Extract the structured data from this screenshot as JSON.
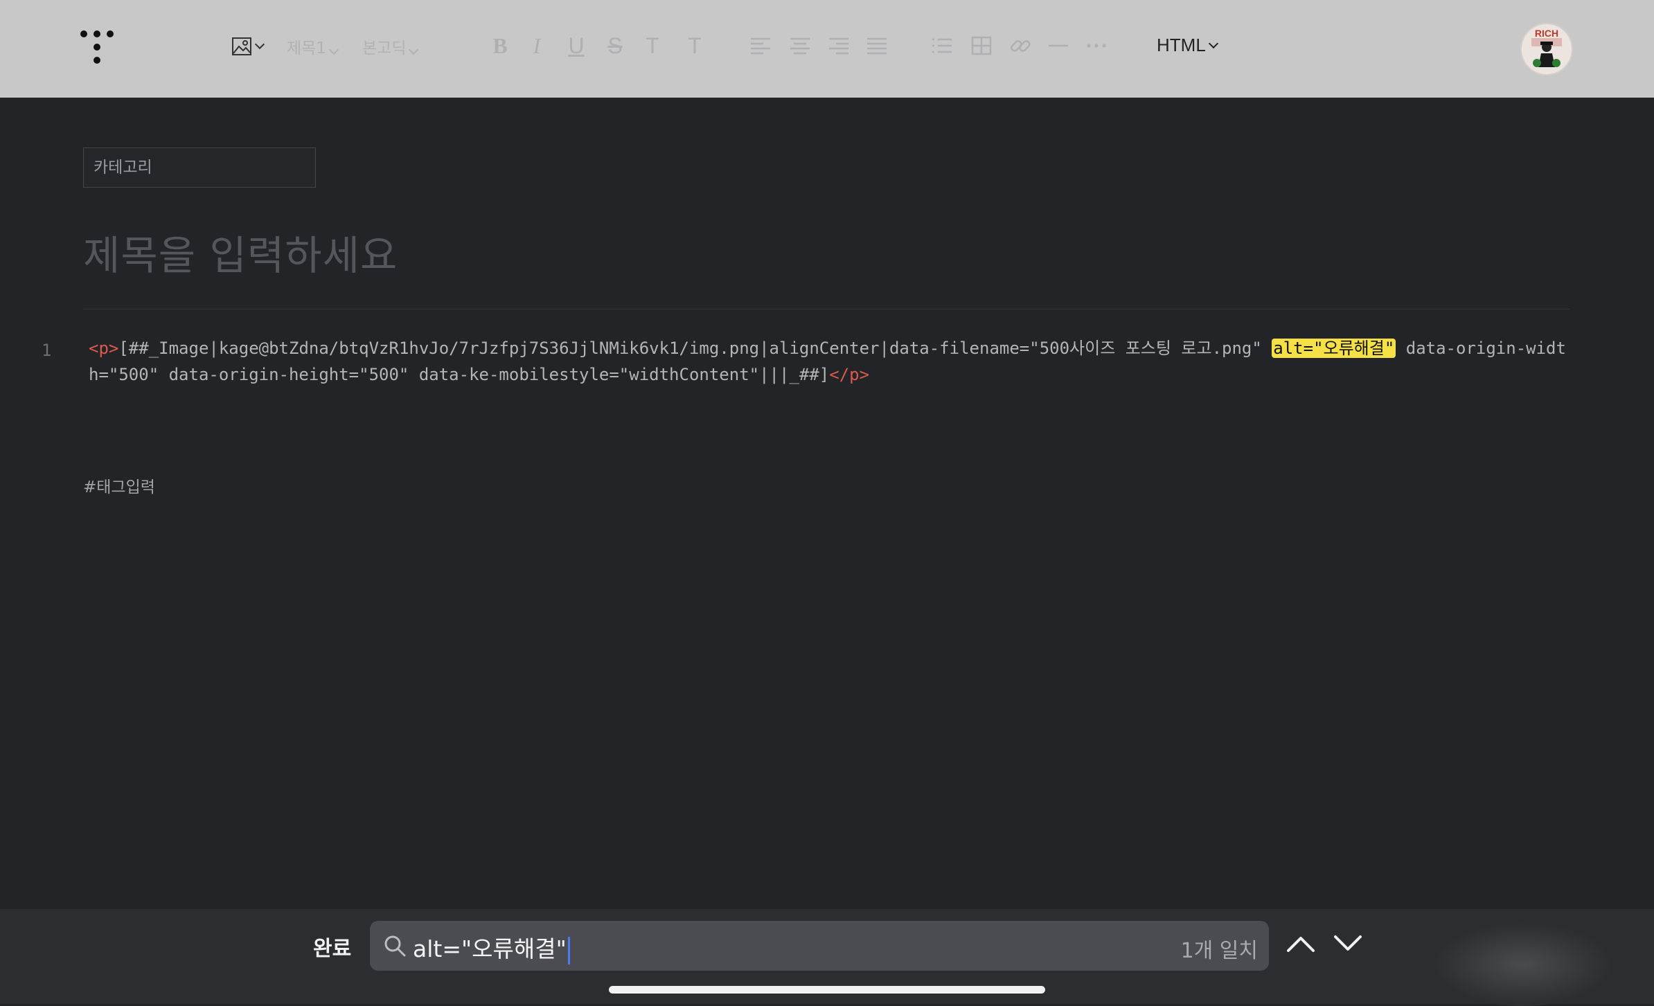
{
  "toolbar": {
    "heading_label": "제목1",
    "font_label": "본고딕",
    "mode_label": "HTML",
    "avatar_text": "RICH"
  },
  "editor": {
    "category_placeholder": "카테고리",
    "title_placeholder": "제목을 입력하세요",
    "line_number": "1",
    "code": {
      "open_tag": "<p>",
      "before": "[##_Image|kage@btZdna/btqVzR1hvJo/7rJzfpj7S36JjlNMik6vk1/img.png|alignCenter|data-filename=\"500사이즈 포스팅 로고.png\" ",
      "highlight": "alt=\"오류해결\"",
      "after": " data-origin-width=\"500\" data-origin-height=\"500\" data-ke-mobilestyle=\"widthContent\"|||_##]",
      "close_tag": "</p>"
    },
    "tags_placeholder": "#태그입력"
  },
  "findbar": {
    "done_label": "완료",
    "search_value": "alt=\"오류해결\"",
    "match_count": "1개 일치"
  },
  "colors": {
    "toolbar_bg": "#c8c8c9",
    "editor_bg": "#232428",
    "tag_color": "#dc5a4b",
    "highlight": "#f5e046",
    "caret": "#4d7cf2"
  }
}
